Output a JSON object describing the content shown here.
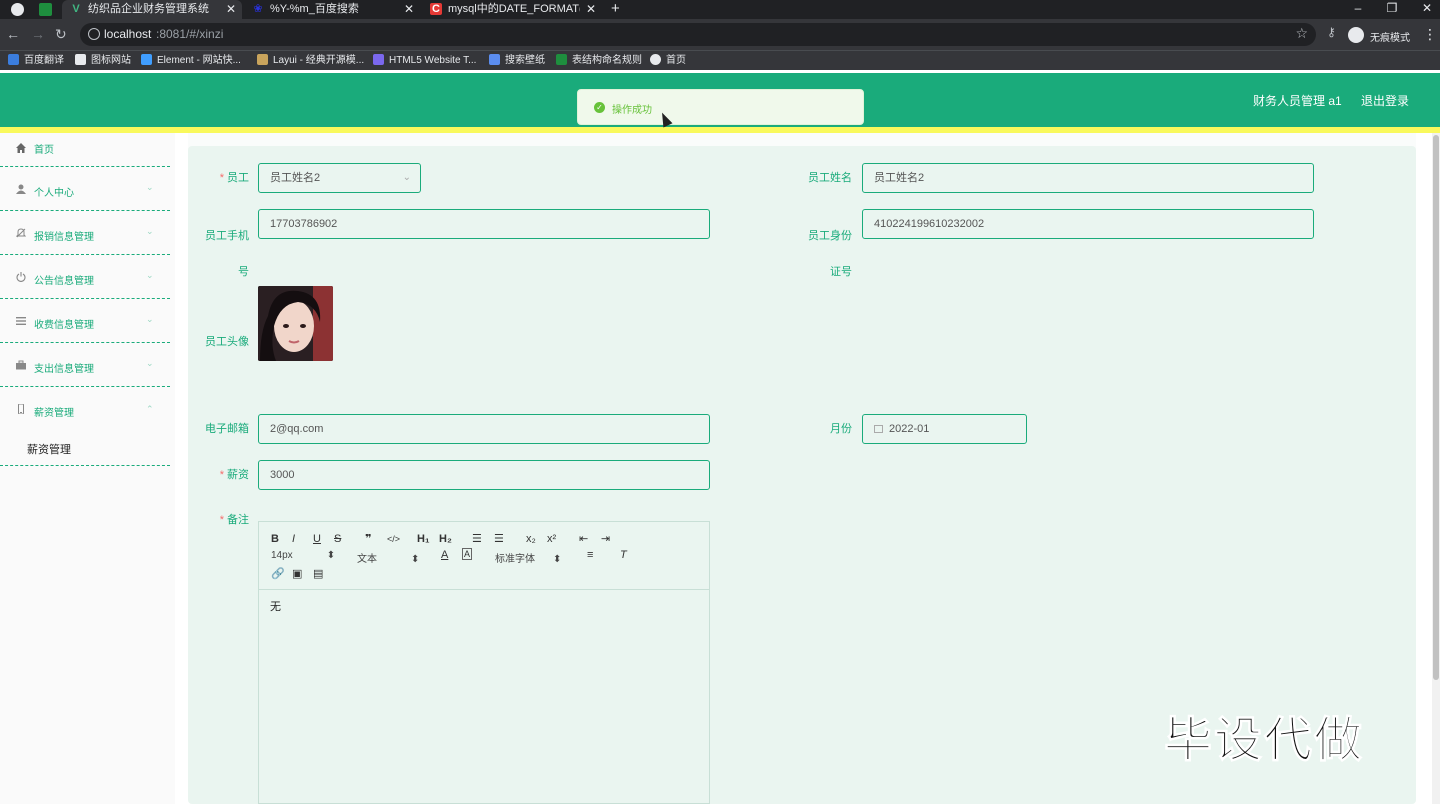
{
  "browser": {
    "tabs": [
      {
        "title": "纺织品企业财务管理系统",
        "active": true
      },
      {
        "title": "%Y-%m_百度搜索",
        "active": false
      },
      {
        "title": "mysql中的DATE_FORMAT(NO",
        "active": false
      }
    ],
    "url_host": "localhost",
    "url_rest": ":8081/#/xinzi",
    "incognito_label": "无痕模式",
    "bookmarks": [
      "百度翻译",
      "图标网站",
      "Element - 网站快...",
      "Layui - 经典开源模...",
      "HTML5 Website T...",
      "搜索壁纸",
      "表结构命名规则",
      "首页"
    ]
  },
  "header": {
    "role_user": "财务人员管理 a1",
    "logout": "退出登录",
    "toast": "操作成功",
    "accent_color": "#1aab7b"
  },
  "sidebar": {
    "items": [
      {
        "label": "首页",
        "icon": "home-icon"
      },
      {
        "label": "个人中心",
        "icon": "user-icon"
      },
      {
        "label": "报销信息管理",
        "icon": "bell-icon"
      },
      {
        "label": "公告信息管理",
        "icon": "power-icon"
      },
      {
        "label": "收费信息管理",
        "icon": "menu-icon"
      },
      {
        "label": "支出信息管理",
        "icon": "briefcase-icon"
      },
      {
        "label": "薪资管理",
        "icon": "mobile-icon"
      }
    ],
    "submenu_item": "薪资管理"
  },
  "form": {
    "employee_label": "员工",
    "employee_value": "员工姓名2",
    "employee_name_label": "员工姓名",
    "employee_name_value": "员工姓名2",
    "phone_label": "员工手机号",
    "phone_value": "17703786902",
    "id_label": "员工身份证号",
    "id_value": "410224199610232002",
    "avatar_label": "员工头像",
    "email_label": "电子邮箱",
    "email_value": "2@qq.com",
    "month_label": "月份",
    "month_value": "2022-01",
    "salary_label": "薪资",
    "salary_value": "3000",
    "remark_label": "备注",
    "remark_value": "无"
  },
  "editor": {
    "font_size": "14px",
    "text_type": "文本",
    "font_family": "标准字体"
  },
  "watermark": "毕设代做"
}
